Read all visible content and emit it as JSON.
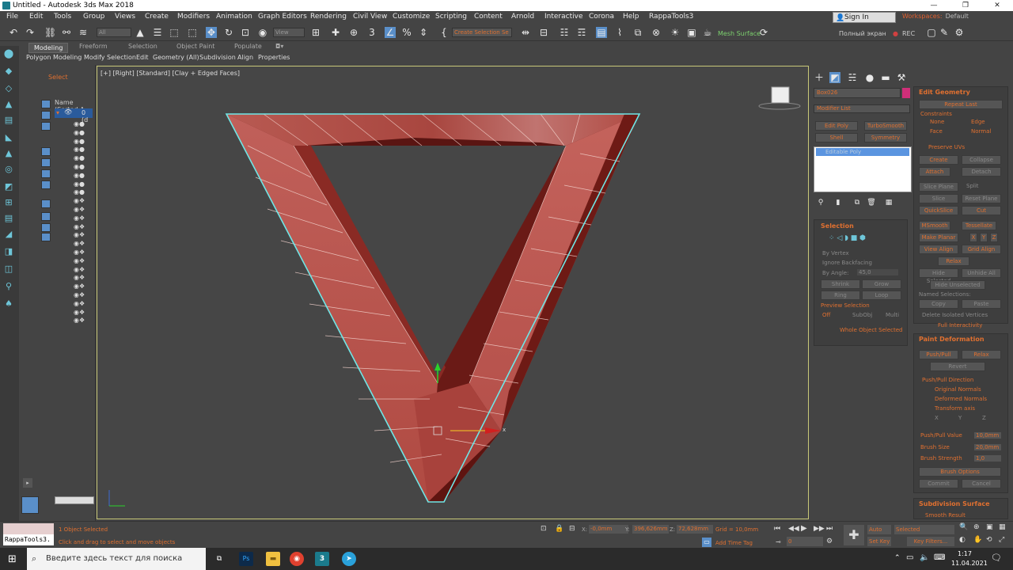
{
  "window": {
    "title": "Untitled - Autodesk 3ds Max 2018"
  },
  "menu": [
    "File",
    "Edit",
    "Tools",
    "Group",
    "Views",
    "Create",
    "Modifiers",
    "Animation",
    "Graph Editors",
    "Rendering",
    "Civil View",
    "Customize",
    "Scripting",
    "Content",
    "Arnold",
    "Interactive",
    "Corona",
    "Help",
    "RappaTools3"
  ],
  "account": {
    "sign_in": "Sign In",
    "workspaces_label": "Workspaces:",
    "workspaces_value": "Default"
  },
  "toolbar": {
    "filter": "All",
    "view": "View",
    "selection_set": "Create Selection Se",
    "mesh_surface": "Mesh Surface",
    "fullscreen": "Полный экран",
    "rec": "REC"
  },
  "ribbon": {
    "tabs": [
      "Modeling",
      "Freeform",
      "Selection",
      "Object Paint",
      "Populate"
    ],
    "sub": [
      "Polygon Modeling",
      "Modify Selection",
      "Edit",
      "Geometry (All)",
      "Subdivision",
      "Align",
      "Properties"
    ]
  },
  "scene_explorer": {
    "select": "Select",
    "column": "Name (Sorted A",
    "first_item": "0 (d"
  },
  "viewport": {
    "label": "[+] [Right] [Standard] [Clay + Edged Faces]",
    "axis_x": "x"
  },
  "modify": {
    "object_name": "Box026",
    "modifier_list": "Modifier List",
    "buttons": [
      "Edit Poly",
      "TurboSmooth",
      "Shell",
      "Symmetry"
    ],
    "stack_item": "Editable Poly",
    "selection": {
      "title": "Selection",
      "by_vertex": "By Vertex",
      "ignore_backfacing": "Ignore Backfacing",
      "by_angle": "By Angle:",
      "angle_value": "45,0",
      "shrink": "Shrink",
      "grow": "Grow",
      "ring": "Ring",
      "loop": "Loop",
      "preview": "Preview Selection",
      "off": "Off",
      "subobj": "SubObj",
      "multi": "Multi",
      "whole": "Whole Object Selected"
    },
    "edit_geometry": {
      "title": "Edit Geometry",
      "repeat_last": "Repeat Last",
      "constraints": "Constraints",
      "none": "None",
      "edge": "Edge",
      "face": "Face",
      "normal": "Normal",
      "preserve_uvs": "Preserve UVs",
      "create": "Create",
      "collapse": "Collapse",
      "attach": "Attach",
      "detach": "Detach",
      "slice_plane": "Slice Plane",
      "split": "Split",
      "slice": "Slice",
      "reset_plane": "Reset Plane",
      "quickslice": "QuickSlice",
      "cut": "Cut",
      "msmooth": "MSmooth",
      "tessellate": "Tessellate",
      "make_planar": "Make Planar",
      "x": "X",
      "y": "Y",
      "z": "Z",
      "view_align": "View Align",
      "grid_align": "Grid Align",
      "relax": "Relax",
      "hide_selected": "Hide Selected",
      "unhide_all": "Unhide All",
      "hide_unselected": "Hide Unselected",
      "named_selections": "Named Selections:",
      "copy": "Copy",
      "paste": "Paste",
      "delete_isolated": "Delete Isolated Vertices",
      "full_interactivity": "Full Interactivity"
    },
    "paint_deformation": {
      "title": "Paint Deformation",
      "push_pull": "Push/Pull",
      "relax": "Relax",
      "revert": "Revert",
      "direction": "Push/Pull Direction",
      "original": "Original Normals",
      "deformed": "Deformed Normals",
      "transform_axis": "Transform axis",
      "x": "X",
      "y": "Y",
      "z": "Z",
      "push_pull_value": "Push/Pull Value",
      "push_pull_num": "10,0mm",
      "brush_size": "Brush Size",
      "brush_size_num": "20,0mm",
      "brush_strength": "Brush Strength",
      "brush_strength_num": "1,0",
      "brush_options": "Brush Options",
      "commit": "Commit",
      "cancel": "Cancel"
    },
    "subdivision": {
      "title": "Subdivision Surface",
      "smooth_result": "Smooth Result"
    }
  },
  "status": {
    "listener": "RappaTools3.",
    "selected": "1 Object Selected",
    "hint": "Click and drag to select and move objects",
    "x_label": "X:",
    "x": "-0,0mm",
    "y_label": "Y:",
    "y": "396,626mm",
    "z_label": "Z:",
    "z": "72,628mm",
    "grid": "Grid = 10,0mm",
    "add_time_tag": "Add Time Tag",
    "auto_key": "Auto Key",
    "set_key": "Set Key",
    "selected_dd": "Selected",
    "key_filters": "Key Filters...",
    "frame": "0"
  },
  "taskbar": {
    "search": "Введите здесь текст для поиска",
    "time": "1:17",
    "date": "11.04.2021"
  }
}
